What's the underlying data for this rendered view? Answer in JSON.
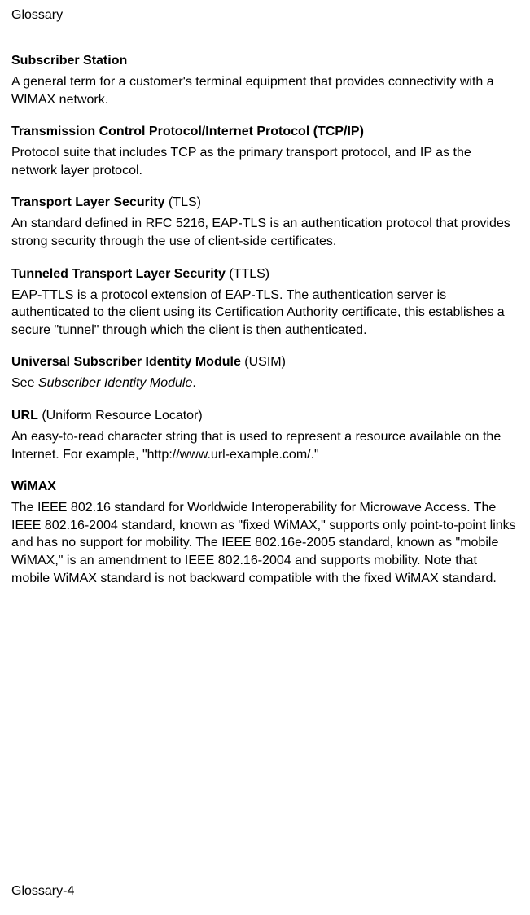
{
  "header": "Glossary",
  "entries": [
    {
      "term": "Subscriber Station",
      "paren": "",
      "definition": "A general term for a customer's terminal equipment that provides connectivity with a WIMAX network."
    },
    {
      "term": "Transmission Control Protocol/Internet Protocol (TCP/IP)",
      "paren": "",
      "definition": "Protocol suite that includes TCP as the primary transport protocol, and IP as the network layer protocol."
    },
    {
      "term": "Transport Layer Security",
      "paren": " (TLS)",
      "definition": "An standard defined in RFC 5216, EAP-TLS is an authentication protocol that provides strong security through the use of client-side certificates."
    },
    {
      "term": "Tunneled Transport Layer Security",
      "paren": " (TTLS)",
      "definition": "EAP-TTLS is a protocol extension of EAP-TLS. The authentication server is authenticated to the client using its Certification Authority certificate, this establishes a secure \"tunnel\" through which the client is then authenticated."
    },
    {
      "term": "Universal Subscriber Identity Module",
      "paren": " (USIM)",
      "definition_prefix": "See ",
      "definition_italic": "Subscriber Identity Module",
      "definition_suffix": "."
    },
    {
      "term": "URL",
      "paren": " (Uniform Resource Locator)",
      "definition": "An easy-to-read character string that is used to represent a resource available on the Internet. For example, \"http://www.url-example.com/.\""
    },
    {
      "term": "WiMAX",
      "paren": "",
      "definition": "The IEEE 802.16 standard for Worldwide Interoperability for Microwave Access. The IEEE 802.16-2004 standard, known as \"fixed WiMAX,\" supports only point-to-point links and has no support for mobility. The IEEE 802.16e-2005 standard, known as \"mobile WiMAX,\" is an amendment to IEEE 802.16-2004 and supports mobility. Note that mobile WiMAX standard is not backward compatible with the fixed WiMAX standard."
    }
  ],
  "footer": "Glossary-4"
}
